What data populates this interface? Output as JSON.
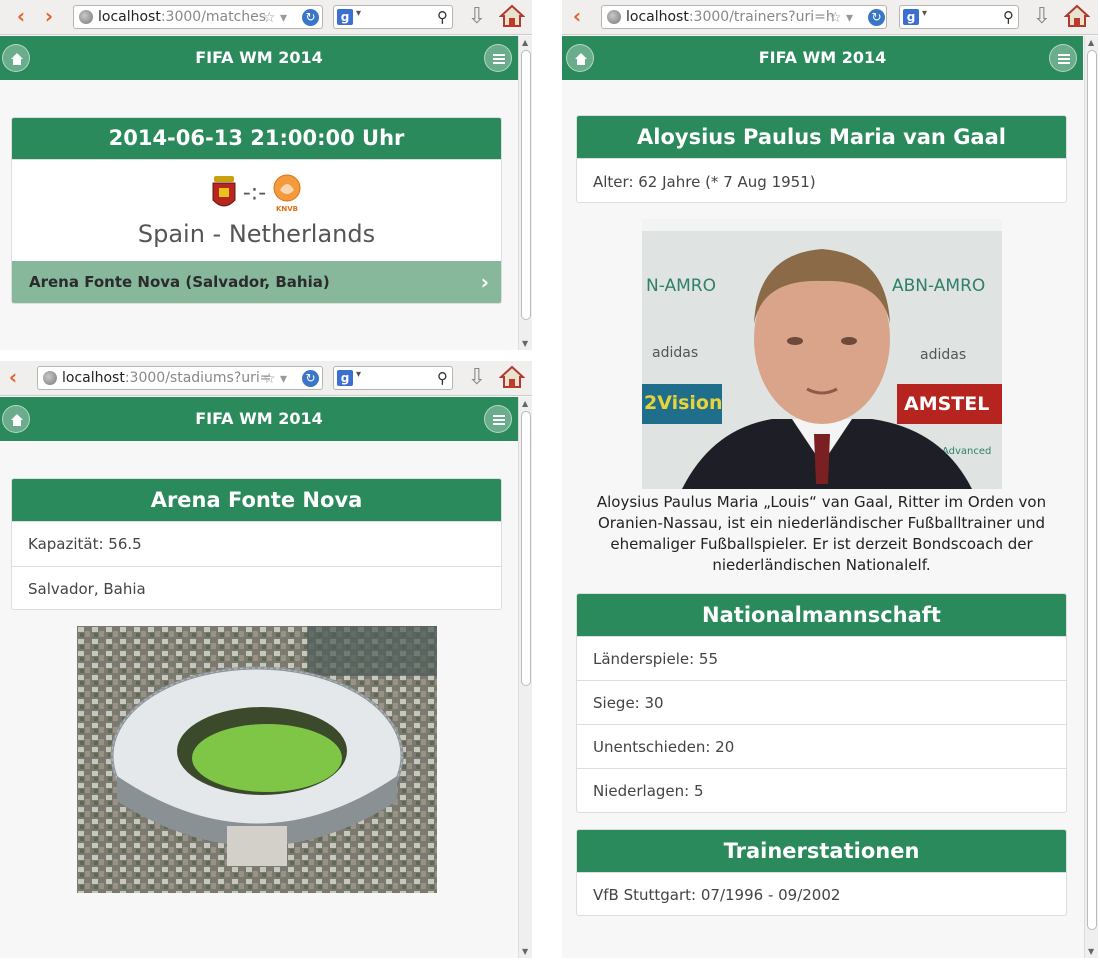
{
  "app": {
    "title": "FIFA WM 2014"
  },
  "matches_window": {
    "url_host": "localhost",
    "url_path": ":3000/matches",
    "datetime": "2014-06-13 21:00:00 Uhr",
    "score": "-:-",
    "teams": "Spain - Netherlands",
    "venue": "Arena Fonte Nova (Salvador, Bahia)",
    "home_crest_label": "",
    "away_crest_label": "KNVB"
  },
  "stadiums_window": {
    "url_host": "localhost",
    "url_path": ":3000/stadiums?uri=",
    "name": "Arena Fonte Nova",
    "capacity": "Kapazität: 56.5",
    "location": "Salvador, Bahia"
  },
  "trainers_window": {
    "url_host": "localhost",
    "url_path": ":3000/trainers?uri=h",
    "name": "Aloysius Paulus Maria van Gaal",
    "age": "Alter: 62 Jahre (* 7 Aug 1951)",
    "bio": "Aloysius Paulus Maria „Louis“ van Gaal, Ritter im Orden von Oranien-Nassau, ist ein niederländischer Fußballtrainer und ehemaliger Fußballspieler. Er ist derzeit Bondscoach der niederländischen Nationalelf.",
    "photo_banner_words": [
      "N-AMRO",
      "ABN-AMRO",
      "adidas",
      "adidas",
      "2Vision",
      "AMSTEL",
      "Advanced"
    ],
    "national_team_heading": "Nationalmannschaft",
    "national_team_rows": [
      "Länderspiele: 55",
      "Siege: 30",
      "Unentschieden: 20",
      "Niederlagen: 5"
    ],
    "stations_heading": "Trainerstationen",
    "stations_rows": [
      "VfB Stuttgart: 07/1996 - 09/2002"
    ]
  },
  "colors": {
    "header_green": "#2a8a5b",
    "venue_bar": "#87b89c",
    "nav_orange": "#e2632a"
  },
  "icons": {
    "home": "home-icon",
    "menu": "menu-icon",
    "back": "back-arrow-icon",
    "forward": "forward-arrow-icon"
  }
}
